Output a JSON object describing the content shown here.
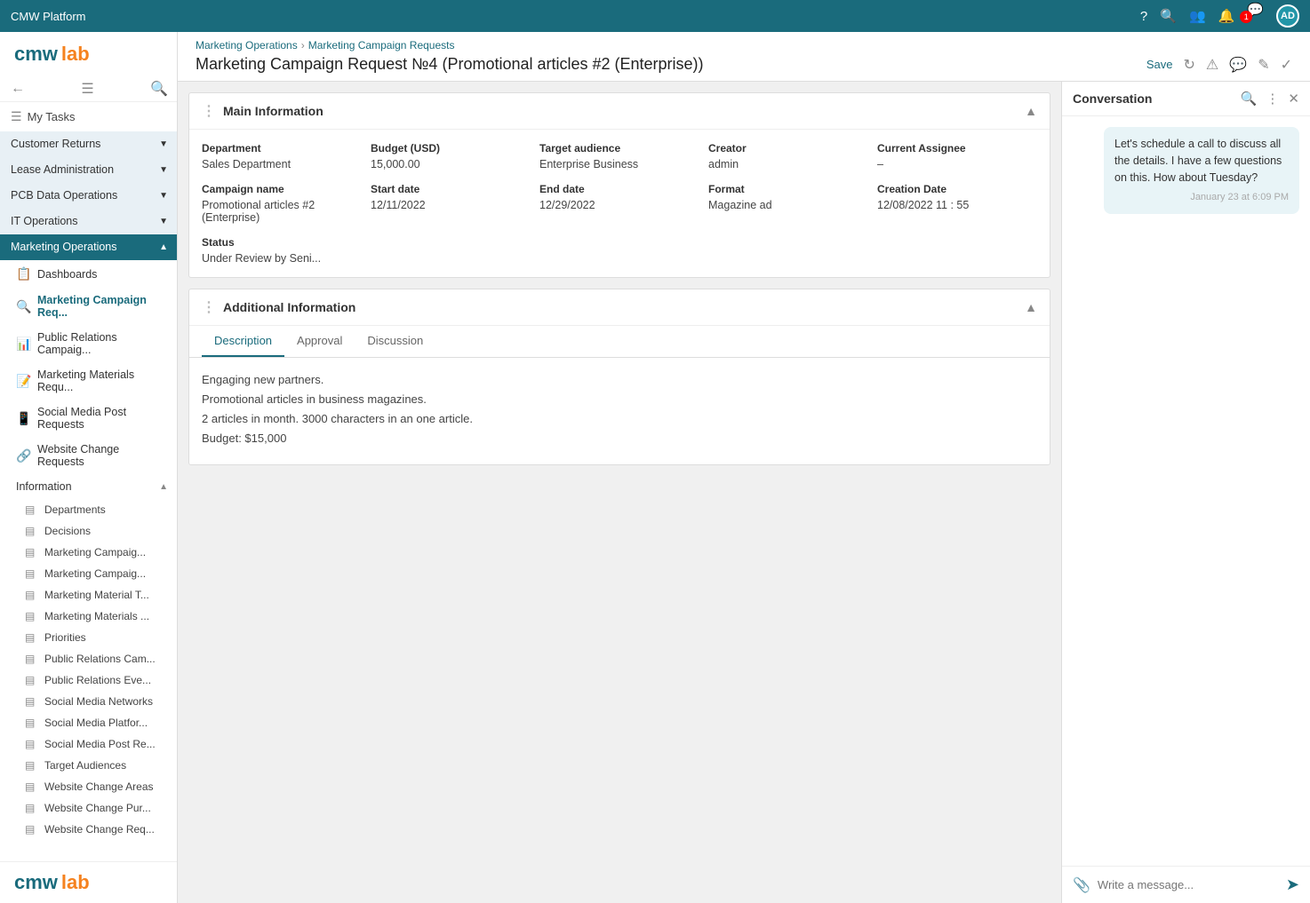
{
  "topbar": {
    "title": "CMW Platform",
    "avatar_initials": "AD",
    "notification_count": "1"
  },
  "sidebar": {
    "logo_cmw": "cmw",
    "logo_lab": "lab",
    "my_tasks_label": "My Tasks",
    "groups": [
      {
        "id": "customer-returns",
        "label": "Customer Returns",
        "active": false
      },
      {
        "id": "lease-administration",
        "label": "Lease Administration",
        "active": false
      },
      {
        "id": "pcb-data-operations",
        "label": "PCB Data Operations",
        "active": false
      },
      {
        "id": "it-operations",
        "label": "IT Operations",
        "active": false
      },
      {
        "id": "marketing-operations",
        "label": "Marketing Operations",
        "active": true
      }
    ],
    "items": [
      {
        "id": "dashboards",
        "label": "Dashboards",
        "icon": "📋"
      },
      {
        "id": "marketing-campaign-req",
        "label": "Marketing Campaign Req...",
        "icon": "🔍",
        "active": true
      },
      {
        "id": "public-relations-campaig",
        "label": "Public Relations Campaig...",
        "icon": "📊"
      },
      {
        "id": "marketing-materials-requ",
        "label": "Marketing Materials Requ...",
        "icon": "📝"
      },
      {
        "id": "social-media-post-requests",
        "label": "Social Media Post Requests",
        "icon": "📱"
      },
      {
        "id": "website-change-requests",
        "label": "Website Change Requests",
        "icon": "🔗"
      }
    ],
    "info_section_label": "Information",
    "info_items": [
      "Departments",
      "Decisions",
      "Marketing Campaig...",
      "Marketing Campaig...",
      "Marketing Material T...",
      "Marketing Materials ...",
      "Priorities",
      "Public Relations Cam...",
      "Public Relations Eve...",
      "Social Media Networks",
      "Social Media Platfor...",
      "Social Media Post Re...",
      "Target Audiences",
      "Website Change Areas",
      "Website Change Pur...",
      "Website Change Req..."
    ],
    "bottom_logo_cmw": "cmw",
    "bottom_logo_lab": "lab"
  },
  "breadcrumb": {
    "items": [
      "Marketing Operations",
      "Marketing Campaign Requests"
    ],
    "separator": "›"
  },
  "page_title": "Marketing Campaign Request №4 (Promotional articles #2 (Enterprise))",
  "header_actions": {
    "save": "Save"
  },
  "main_info": {
    "section_title": "Main Information",
    "fields": [
      {
        "label": "Department",
        "value": "Sales Department"
      },
      {
        "label": "Budget (USD)",
        "value": "15,000.00"
      },
      {
        "label": "Target audience",
        "value": "Enterprise Business"
      },
      {
        "label": "Creator",
        "value": "admin"
      },
      {
        "label": "Current Assignee",
        "value": "–"
      },
      {
        "label": "Campaign name",
        "value": "Promotional articles #2 (Enterprise)"
      },
      {
        "label": "Start date",
        "value": "12/11/2022"
      },
      {
        "label": "End date",
        "value": "12/29/2022"
      },
      {
        "label": "Format",
        "value": "Magazine ad"
      },
      {
        "label": "Creation Date",
        "value": "12/08/2022  11 : 55"
      },
      {
        "label": "Status",
        "value": "Under Review by Seni..."
      }
    ]
  },
  "additional_info": {
    "section_title": "Additional Information",
    "tabs": [
      "Description",
      "Approval",
      "Discussion"
    ],
    "active_tab": "Description",
    "description_text": "Engaging new partners.\nPromotional articles in business magazines.\n2 articles in month. 3000 characters in an one article.\nBudget: $15,000"
  },
  "conversation": {
    "title": "Conversation",
    "message": "Let's schedule a call to discuss all the details. I have a few questions on this. How about Tuesday?",
    "timestamp": "January 23 at 6:09 PM",
    "input_placeholder": "Write a message..."
  }
}
